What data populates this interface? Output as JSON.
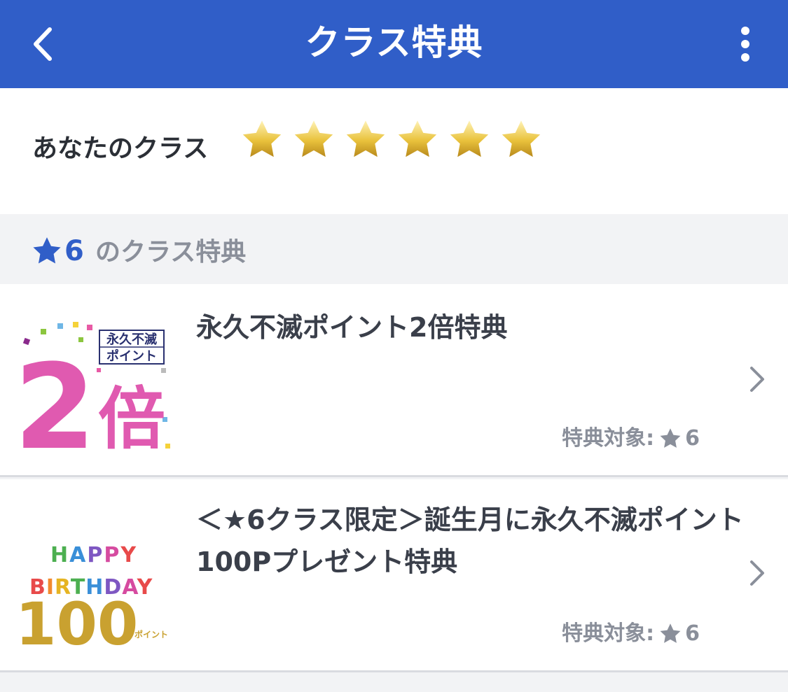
{
  "header": {
    "title": "クラス特典",
    "back_icon": "chevron-left-icon",
    "more_icon": "more-vertical-icon",
    "bg_color": "#305ec8"
  },
  "class_summary": {
    "label": "あなたのクラス",
    "star_count": 6,
    "star_color": "#e9c23c"
  },
  "section": {
    "star_icon": "star-icon",
    "class_number": "6",
    "label": "のクラス特典"
  },
  "items": [
    {
      "title": "永久不滅ポイント2倍特典",
      "thumb": {
        "line1": "永久不滅",
        "line2": "ポイント",
        "big_number": "2",
        "big_kanji": "倍"
      },
      "target_label": "特典対象:",
      "target_class": "6"
    },
    {
      "title": "＜★6クラス限定＞誕生月に永久不滅ポイント100Pプレゼント特典",
      "thumb": {
        "happy": "HAPPY",
        "birthday": "BIRTHDAY",
        "amount": "100",
        "unit": "ポイント"
      },
      "target_label": "特典対象:",
      "target_class": "6"
    }
  ]
}
